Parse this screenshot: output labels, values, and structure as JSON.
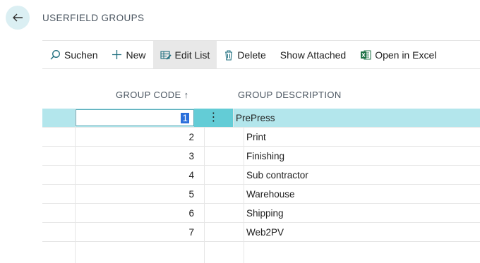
{
  "page": {
    "title": "USERFIELD GROUPS"
  },
  "toolbar": {
    "items": [
      {
        "label": "Suchen",
        "icon": "search-icon"
      },
      {
        "label": "New",
        "icon": "plus-icon"
      },
      {
        "label": "Edit List",
        "icon": "edit-list-icon"
      },
      {
        "label": "Delete",
        "icon": "trash-icon"
      },
      {
        "label": "Show Attached"
      },
      {
        "label": "Open in Excel",
        "icon": "excel-icon"
      }
    ]
  },
  "table": {
    "headers": {
      "code": "GROUP CODE ↑",
      "description": "GROUP DESCRIPTION"
    },
    "rows": [
      {
        "code": "1",
        "description": "PrePress"
      },
      {
        "code": "2",
        "description": "Print"
      },
      {
        "code": "3",
        "description": "Finishing"
      },
      {
        "code": "4",
        "description": "Sub contractor"
      },
      {
        "code": "5",
        "description": "Warehouse"
      },
      {
        "code": "6",
        "description": "Shipping"
      },
      {
        "code": "7",
        "description": "Web2PV"
      }
    ]
  },
  "colors": {
    "selected_row": "#b3e6ec",
    "accent": "#63ccd6",
    "back_button": "#dbeff3",
    "excel_green": "#1e7145"
  }
}
